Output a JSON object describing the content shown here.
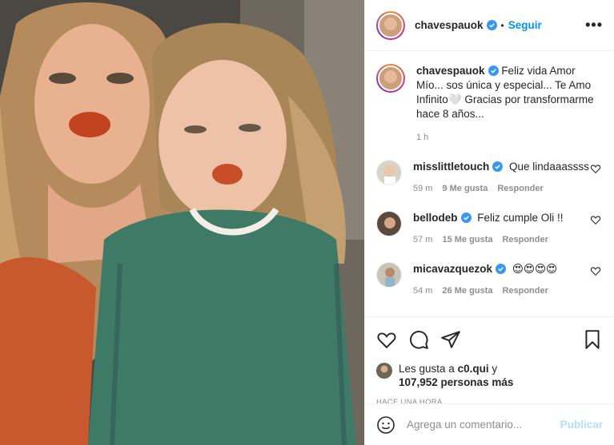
{
  "post": {
    "author": "chavespauok",
    "follow_label": "Seguir",
    "dot": "•",
    "more_label": "•••",
    "caption": "Feliz vida Amor Mío... sos única y especial... Te Amo Infinito🤍 Gracias por transformarme hace 8 años...",
    "caption_time": "1 h"
  },
  "comments": [
    {
      "user": "misslittletouch",
      "text": "Que lindaaassss",
      "time": "59 m",
      "likes": "9 Me gusta",
      "reply": "Responder"
    },
    {
      "user": "bellodeb",
      "text": "Feliz cumple Oli !!",
      "time": "57 m",
      "likes": "15 Me gusta",
      "reply": "Responder"
    },
    {
      "user": "micavazquezok",
      "text": "😍😍😍😍",
      "time": "54 m",
      "likes": "26 Me gusta",
      "reply": "Responder"
    }
  ],
  "likes": {
    "prefix": "Les gusta a",
    "user": "c0.qui",
    "connector": "y",
    "others": "107,952 personas más"
  },
  "posted_ago": "HACE UNA HORA",
  "add_comment": {
    "placeholder": "Agrega un comentario...",
    "publish_label": "Publicar"
  },
  "colors": {
    "accent": "#0095f6",
    "publish_disabled": "#b2dffc",
    "verified": "#3897f0",
    "muted": "#8e8e8e"
  }
}
